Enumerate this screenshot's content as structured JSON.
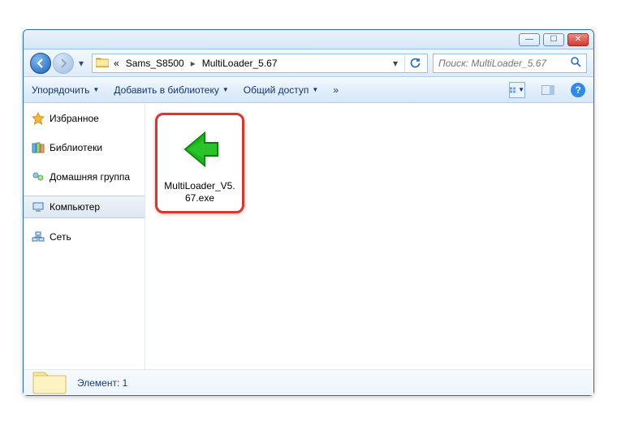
{
  "breadcrumb": {
    "parent": "Sams_S8500",
    "current": "MultiLoader_5.67"
  },
  "search": {
    "placeholder": "Поиск: MultiLoader_5.67"
  },
  "toolbar": {
    "organize": "Упорядочить",
    "add_library": "Добавить в библиотеку",
    "share": "Общий доступ",
    "overflow": "»"
  },
  "sidebar": {
    "favorites": "Избранное",
    "libraries": "Библиотеки",
    "homegroup": "Домашняя группа",
    "computer": "Компьютер",
    "network": "Сеть"
  },
  "file": {
    "name": "MultiLoader_V5.67.exe"
  },
  "status": {
    "label": "Элемент: 1"
  }
}
